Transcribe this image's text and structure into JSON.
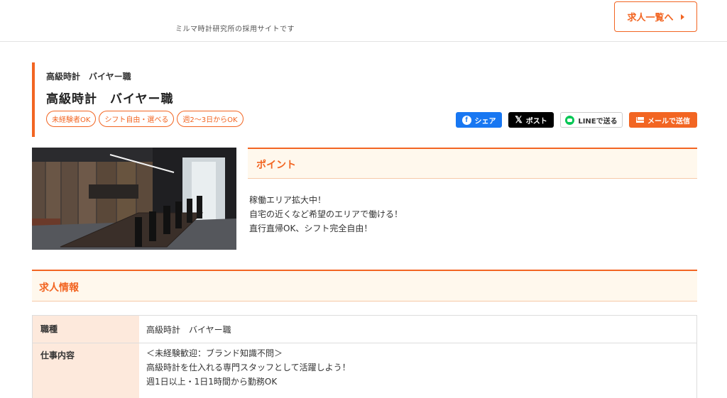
{
  "header": {
    "tagline": "ミルマ時計研究所の採用サイトです",
    "jobs_button": "求人一覧へ"
  },
  "job": {
    "subtitle": "高級時計　バイヤー職",
    "title": "高級時計　バイヤー職",
    "tags": [
      "未経験者OK",
      "シフト自由・選べる",
      "週2〜3日からOK"
    ]
  },
  "share": {
    "facebook": "シェア",
    "x": "ポスト",
    "line": "LINEで送る",
    "mail": "メールで送信"
  },
  "point": {
    "title": "ポイント",
    "lines": [
      "稼働エリア拡大中！",
      "自宅の近くなど希望のエリアで働ける！",
      "直行直帰OK、シフト完全自由！"
    ]
  },
  "info": {
    "title": "求人情報",
    "rows": [
      {
        "label": "職種",
        "lines": [
          "高級時計　バイヤー職"
        ]
      },
      {
        "label": "仕事内容",
        "lines": [
          "＜未経験歓迎：ブランド知識不問＞",
          "高級時計を仕入れる専門スタッフとして活躍しよう！",
          "週1日以上・1日1時間から勤務OK"
        ]
      }
    ]
  },
  "colors": {
    "accent": "#f26522",
    "facebook": "#1877f2",
    "line": "#06c755"
  },
  "icons": [
    "chevron-right-icon",
    "facebook-icon",
    "x-icon",
    "line-icon",
    "mail-icon"
  ]
}
